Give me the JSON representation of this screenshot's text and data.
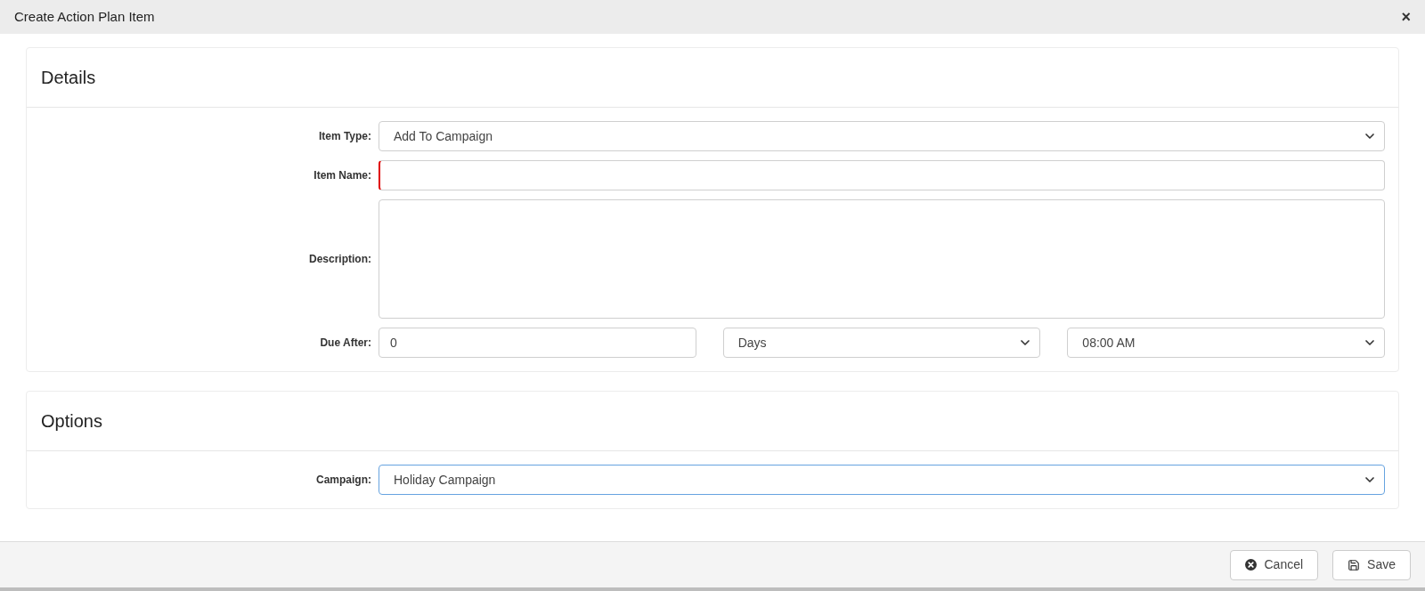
{
  "window": {
    "title": "Create Action Plan Item",
    "close": "×"
  },
  "sections": [
    {
      "title": "Details",
      "rows": [
        {
          "label": "Item Type:",
          "controls": [
            {
              "kind": "select",
              "value": "Add To Campaign",
              "invalid": false,
              "focused": false
            }
          ]
        },
        {
          "label": "Item Name:",
          "controls": [
            {
              "kind": "input",
              "invalid": true,
              "focused": false
            }
          ]
        },
        {
          "label": "Description:",
          "controls": [
            {
              "kind": "textarea",
              "invalid": false,
              "focused": false
            }
          ]
        },
        {
          "label": "Due After:",
          "controls": [
            {
              "kind": "input",
              "value": "0",
              "invalid": false,
              "focused": false
            },
            {
              "kind": "select",
              "value": "Days",
              "invalid": false,
              "focused": false
            },
            {
              "kind": "select",
              "value": "08:00 AM",
              "invalid": false,
              "focused": false
            }
          ]
        }
      ]
    },
    {
      "title": "Options",
      "rows": [
        {
          "label": "Campaign:",
          "controls": [
            {
              "kind": "select",
              "value": "Holiday Campaign",
              "invalid": false,
              "focused": true
            }
          ]
        }
      ]
    }
  ],
  "buttons": [
    {
      "kind": "cancel",
      "label": "Cancel"
    },
    {
      "kind": "save",
      "label": "Save"
    }
  ]
}
